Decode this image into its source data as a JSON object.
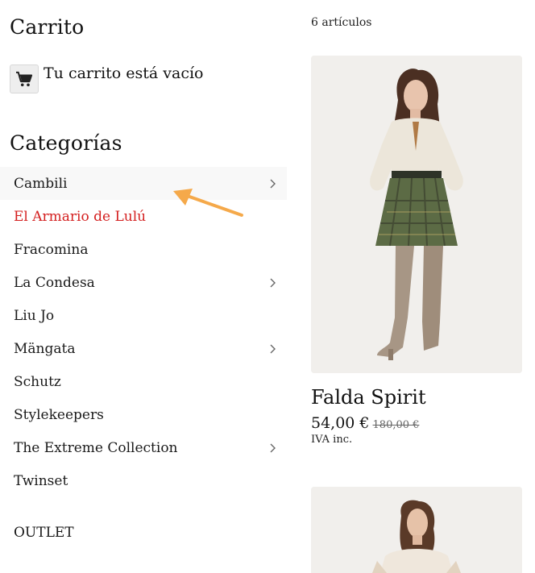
{
  "cart": {
    "title": "Carrito",
    "empty_text": "Tu carrito está vacío",
    "icon": "shopping-cart-icon"
  },
  "categories": {
    "title": "Categorías",
    "items": [
      {
        "label": "Cambili",
        "has_submenu": true
      },
      {
        "label": "El Armario de Lulú",
        "has_submenu": false
      },
      {
        "label": "Fracomina",
        "has_submenu": false
      },
      {
        "label": "La Condesa",
        "has_submenu": true
      },
      {
        "label": "Liu Jo",
        "has_submenu": false
      },
      {
        "label": "Mängata",
        "has_submenu": true
      },
      {
        "label": "Schutz",
        "has_submenu": false
      },
      {
        "label": "Stylekeepers",
        "has_submenu": false
      },
      {
        "label": "The Extreme Collection",
        "has_submenu": true
      },
      {
        "label": "Twinset",
        "has_submenu": false
      }
    ],
    "outlet": "OUTLET",
    "active_color": "#d42020",
    "annotation_arrow_color": "#f5a94a"
  },
  "products": {
    "count": "6 artículos",
    "items": [
      {
        "name": "Falda Spirit",
        "price": "54,00 €",
        "old_price": "180,00 €",
        "tax_note": "IVA inc."
      }
    ]
  }
}
